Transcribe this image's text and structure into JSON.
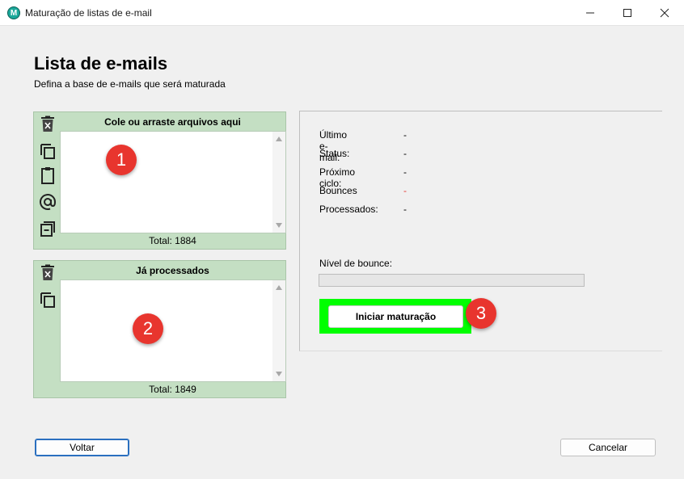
{
  "window": {
    "title": "Maturação de listas de e-mail",
    "icon_letter": "M",
    "accent_color": "#1aa89a"
  },
  "page": {
    "heading": "Lista de e-mails",
    "subheading": "Defina a base de e-mails que será maturada"
  },
  "input_panel": {
    "header": "Cole ou arraste arquivos aqui",
    "total": "Total: 1884",
    "tools": [
      "delete-icon",
      "copy-icon",
      "paste-icon",
      "at-sign-icon",
      "remove-duplicates-icon"
    ],
    "annotation": "1"
  },
  "processed_panel": {
    "header": "Já processados",
    "total": "Total: 1849",
    "tools": [
      "delete-icon",
      "copy-icon"
    ],
    "annotation": "2"
  },
  "status": {
    "rows": [
      {
        "label": "Último e-mail:",
        "value": "-"
      },
      {
        "label": "Status:",
        "value": "-"
      },
      {
        "label": "Próximo ciclo:",
        "value": "-"
      },
      {
        "label": "Bounces",
        "value": "-"
      },
      {
        "label": "Processados:",
        "value": "-"
      }
    ],
    "bounce_label": "Nível de bounce:",
    "bounce_level": 0,
    "start_button": "Iniciar maturação",
    "start_highlight_color": "#00ff00",
    "annotation": "3",
    "annotation_color": "#e8352e"
  },
  "footer": {
    "back_button": "Voltar",
    "cancel_button": "Cancelar"
  }
}
